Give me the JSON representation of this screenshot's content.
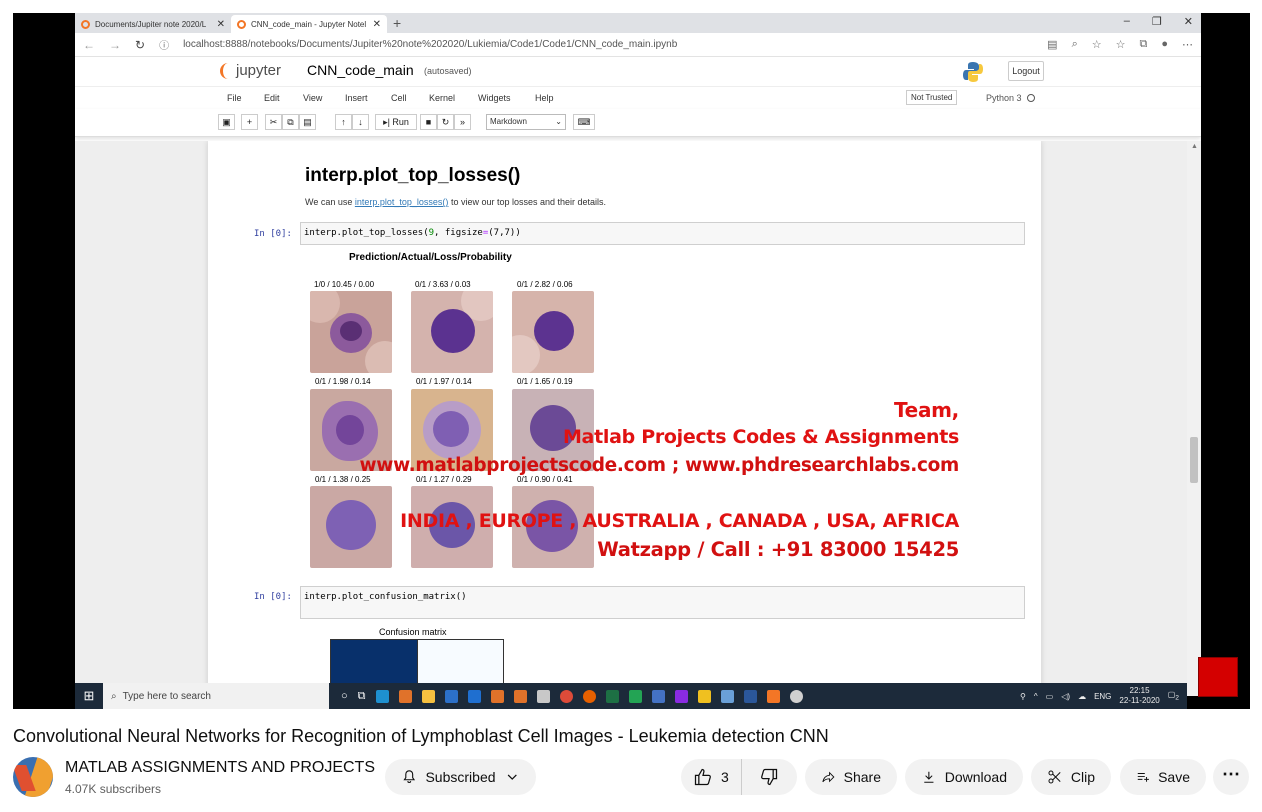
{
  "browser": {
    "tabs": [
      {
        "title": "Documents/Jupiter note 2020/L",
        "active": false
      },
      {
        "title": "CNN_code_main - Jupyter Notel",
        "active": true
      }
    ],
    "url": "localhost:8888/notebooks/Documents/Jupiter%20note%202020/Lukiemia/Code1/Code1/CNN_code_main.ipynb"
  },
  "jupyter": {
    "logo_text": "jupyter",
    "notebook_name": "CNN_code_main",
    "autosaved": "(autosaved)",
    "logout": "Logout",
    "menu": [
      "File",
      "Edit",
      "View",
      "Insert",
      "Cell",
      "Kernel",
      "Widgets",
      "Help"
    ],
    "not_trusted": "Not Trusted",
    "kernel": "Python 3",
    "run_label": "Run",
    "cell_type": "Markdown"
  },
  "notebook": {
    "heading": "interp.plot_top_losses()",
    "para_prefix": "We can use ",
    "para_link": "interp.plot_top_losses()",
    "para_suffix": " to view our top losses and their details.",
    "prompt1": "In [0]:",
    "code1_fn": "interp.plot_top_losses(",
    "code1_num": "9",
    "code1_mid": ", figsize",
    "code1_eq": "=",
    "code1_tuple": "(7,7))",
    "figure_title": "Prediction/Actual/Loss/Probability",
    "losses": [
      "1/0 / 10.45 / 0.00",
      "0/1 / 3.63 / 0.03",
      "0/1 / 2.82 / 0.06",
      "0/1 / 1.98 / 0.14",
      "0/1 / 1.97 / 0.14",
      "0/1 / 1.65 / 0.19",
      "0/1 / 1.38 / 0.25",
      "0/1 / 1.27 / 0.29",
      "0/1 / 0.90 / 0.41"
    ],
    "prompt2": "In [0]:",
    "code2": "interp.plot_confusion_matrix()",
    "confusion_title": "Confusion matrix"
  },
  "watermark": {
    "line1": "Team,",
    "line2": "Matlab Projects Codes & Assignments",
    "line3": "www.matlabprojectscode.com ; www.phdresearchlabs.com",
    "line4": "INDIA , EUROPE , AUSTRALIA , CANADA , USA, AFRICA",
    "line5": "Watzapp / Call : +91 83000 15425"
  },
  "taskbar": {
    "search_placeholder": "Type here to search",
    "lang": "ENG",
    "time": "22:15",
    "date": "22-11-2020",
    "notif_count": "2"
  },
  "video": {
    "title": "Convolutional Neural Networks for Recognition of Lymphoblast Cell Images - Leukemia detection CNN",
    "channel": "MATLAB ASSIGNMENTS AND PROJECTS",
    "subscribers": "4.07K subscribers",
    "subscribed_label": "Subscribed",
    "like_count": "3",
    "share_label": "Share",
    "download_label": "Download",
    "clip_label": "Clip",
    "save_label": "Save"
  },
  "colors": {
    "jupyter_orange": "#f37626",
    "watermark_red": "#e01212",
    "confusion_dark": "#08306b"
  }
}
